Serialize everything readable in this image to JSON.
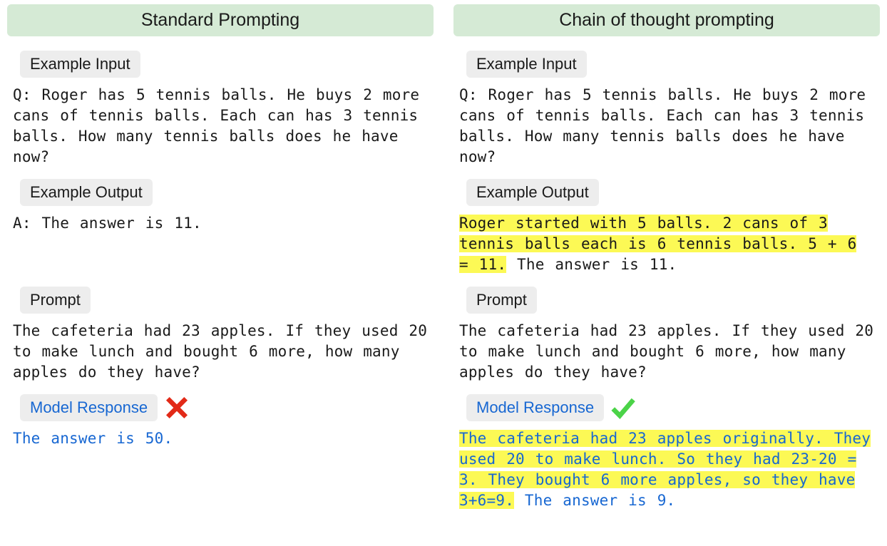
{
  "left": {
    "title": "Standard Prompting",
    "labels": {
      "example_input": "Example Input",
      "example_output": "Example Output",
      "prompt": "Prompt",
      "model_response": "Model Response"
    },
    "example_input_text": "Q: Roger has 5 tennis balls. He buys 2 more cans of tennis balls. Each can has 3 tennis balls. How many tennis balls does he have now?",
    "example_output_text": "A: The answer is 11.",
    "prompt_text": "The cafeteria had 23 apples. If they used 20 to make lunch and bought 6 more, how many apples do they have?",
    "model_response_text": "The answer is 50.",
    "result": "incorrect"
  },
  "right": {
    "title": "Chain of thought prompting",
    "labels": {
      "example_input": "Example Input",
      "example_output": "Example Output",
      "prompt": "Prompt",
      "model_response": "Model Response"
    },
    "example_input_text": "Q: Roger has 5 tennis balls. He buys 2 more cans of tennis balls. Each can has 3 tennis balls. How many tennis balls does he have now?",
    "example_output_highlight": "Roger started with 5 balls. 2 cans of 3 tennis balls each is 6 tennis balls. 5 + 6 = 11.",
    "example_output_rest": " The answer is 11.",
    "prompt_text": "The cafeteria had 23 apples. If they used 20 to make lunch and bought 6 more, how many apples do they have?",
    "model_response_highlight": "The cafeteria had 23 apples originally. They used 20 to make lunch. So they had 23-20 = 3. They bought 6 more apples, so they have 3+6=9.",
    "model_response_rest": " The answer is 9.",
    "result": "correct"
  },
  "icons": {
    "cross": "cross-icon",
    "check": "check-icon"
  },
  "colors": {
    "title_bg": "#d5ead5",
    "chip_bg": "#ededed",
    "highlight": "#fcf955",
    "model_text": "#1767d2",
    "cross": "#e22a18",
    "check": "#4bd348"
  }
}
